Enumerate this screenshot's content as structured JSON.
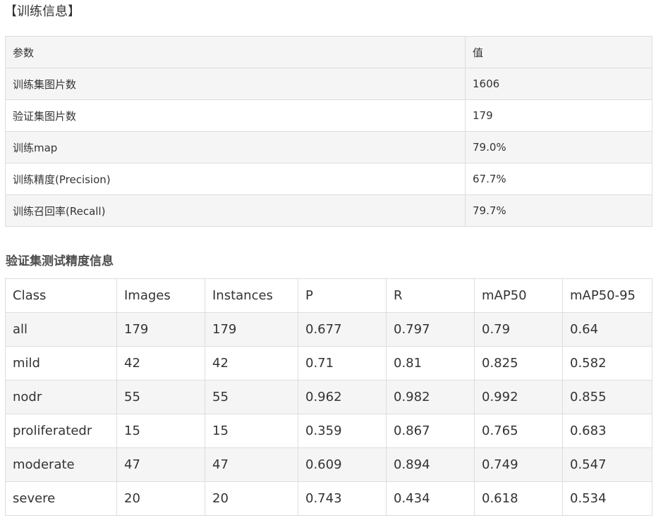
{
  "training_info": {
    "heading": "【训练信息】",
    "header": [
      "参数",
      "值"
    ],
    "rows": [
      [
        "训练集图片数",
        "1606"
      ],
      [
        "验证集图片数",
        "179"
      ],
      [
        "训练map",
        "79.0%"
      ],
      [
        "训练精度(Precision)",
        "67.7%"
      ],
      [
        "训练召回率(Recall)",
        "79.7%"
      ]
    ]
  },
  "validation_info": {
    "heading": "验证集测试精度信息",
    "header": [
      "Class",
      "Images",
      "Instances",
      "P",
      "R",
      "mAP50",
      "mAP50-95"
    ],
    "rows": [
      [
        "all",
        "179",
        "179",
        "0.677",
        "0.797",
        "0.79",
        "0.64"
      ],
      [
        "mild",
        "42",
        "42",
        "0.71",
        "0.81",
        "0.825",
        "0.582"
      ],
      [
        "nodr",
        "55",
        "55",
        "0.962",
        "0.982",
        "0.992",
        "0.855"
      ],
      [
        "proliferatedr",
        "15",
        "15",
        "0.359",
        "0.867",
        "0.765",
        "0.683"
      ],
      [
        "moderate",
        "47",
        "47",
        "0.609",
        "0.894",
        "0.749",
        "0.547"
      ],
      [
        "severe",
        "20",
        "20",
        "0.743",
        "0.434",
        "0.618",
        "0.534"
      ]
    ]
  }
}
